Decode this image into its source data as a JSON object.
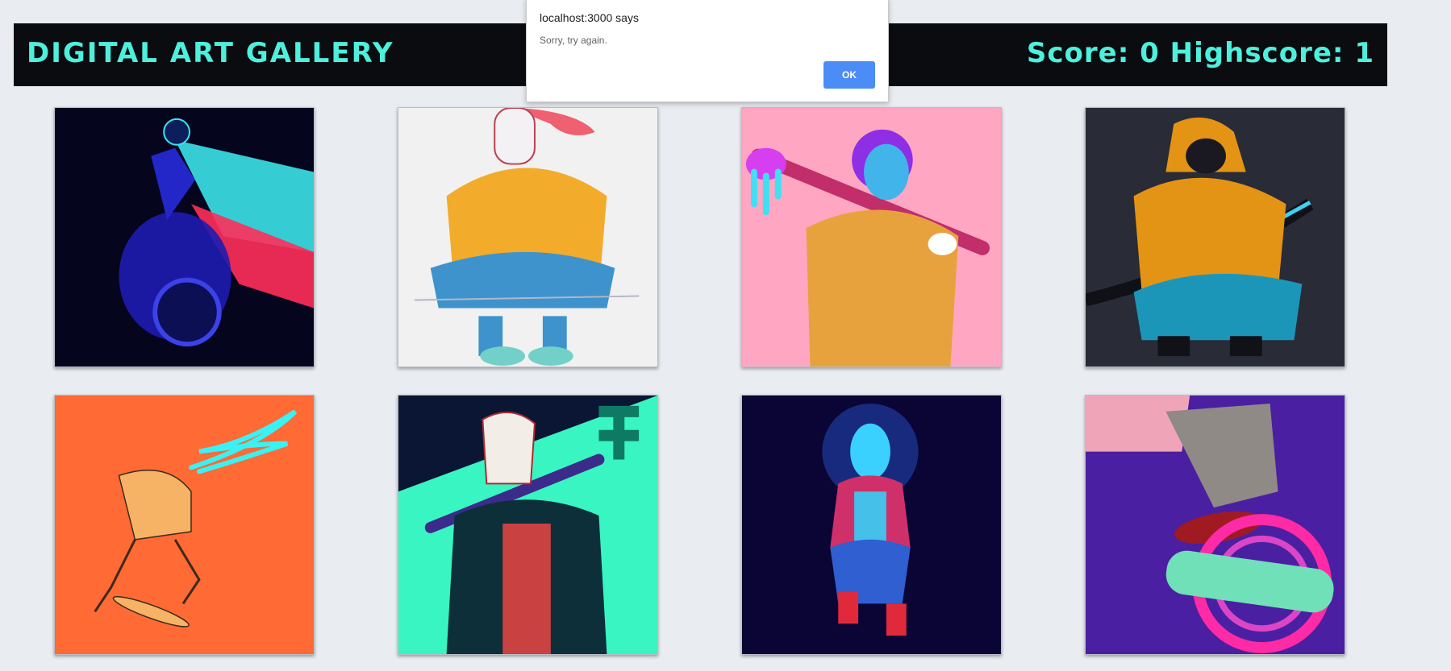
{
  "header": {
    "title": "DIGITAL ART GALLERY",
    "score_text": "Score: 0",
    "highscore_text": "Highscore: 1"
  },
  "dialog": {
    "origin": "localhost:3000 says",
    "message": "Sorry, try again.",
    "ok_label": "OK"
  },
  "gallery": {
    "cards": [
      {
        "subject": "motorcycle rider",
        "background": "#05061e",
        "accent": "#3ef0f4"
      },
      {
        "subject": "fox mask hoodie crouching",
        "background": "#f1f1f1",
        "accent": "#f0a52a"
      },
      {
        "subject": "oni with bat",
        "background": "#ffa6c2",
        "accent": "#e4a13e"
      },
      {
        "subject": "hooded figure with katana",
        "background": "#292b37",
        "accent": "#e29415"
      },
      {
        "subject": "skater sketch",
        "background": "#ff6a35",
        "accent": "#3af1f3"
      },
      {
        "subject": "kitsune mask jacket",
        "background": "#0b1634",
        "accent": "#38f5c1"
      },
      {
        "subject": "glowing fox spirit",
        "background": "#0a0535",
        "accent": "#3ad0ff"
      },
      {
        "subject": "skateboard kickflip",
        "background": "#4b1fa1",
        "accent": "#ff2aa5"
      }
    ]
  }
}
